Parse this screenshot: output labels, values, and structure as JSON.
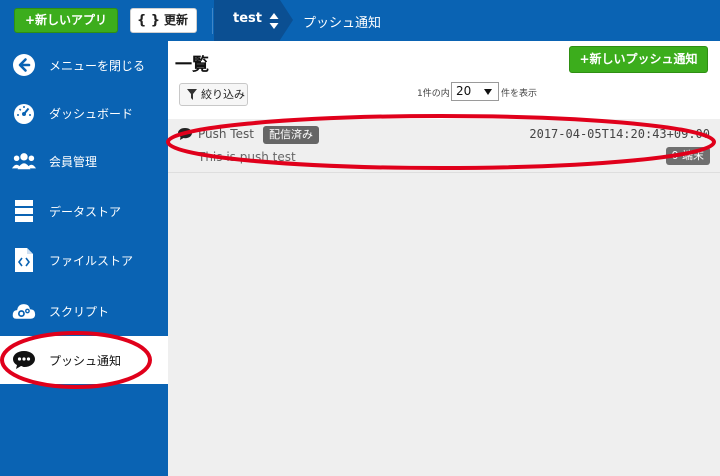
{
  "topbar": {
    "new_app_label": "+新しいアプリ",
    "refresh_icon": "{ }",
    "refresh_label": "更新",
    "app_name": "test",
    "breadcrumb": "プッシュ通知",
    "brand_color": "#0a63b3",
    "accent_color": "#3cad1c"
  },
  "sidebar": {
    "items": [
      {
        "label": "メニューを閉じる",
        "icon": "arrow-left-circle-icon"
      },
      {
        "label": "ダッシュボード",
        "icon": "gauge-icon"
      },
      {
        "label": "会員管理",
        "icon": "users-icon"
      },
      {
        "label": "データストア",
        "icon": "database-icon"
      },
      {
        "label": "ファイルストア",
        "icon": "code-file-icon"
      },
      {
        "label": "スクリプト",
        "icon": "cloud-gear-icon"
      },
      {
        "label": "プッシュ通知",
        "icon": "chat-bubble-icon",
        "active": true
      }
    ]
  },
  "main": {
    "title": "一覧",
    "new_push_label": "+新しいプッシュ通知",
    "filter_label": "絞り込み",
    "pager_prefix": "1件の内",
    "pager_value": "20",
    "pager_suffix": "件を表示",
    "rows": [
      {
        "title": "Push Test",
        "status": "配信済み",
        "timestamp": "2017-04-05T14:20:43+09:00",
        "body": "This is push test",
        "devices": "0 端末"
      }
    ]
  },
  "annotation_color": "#e0001b"
}
